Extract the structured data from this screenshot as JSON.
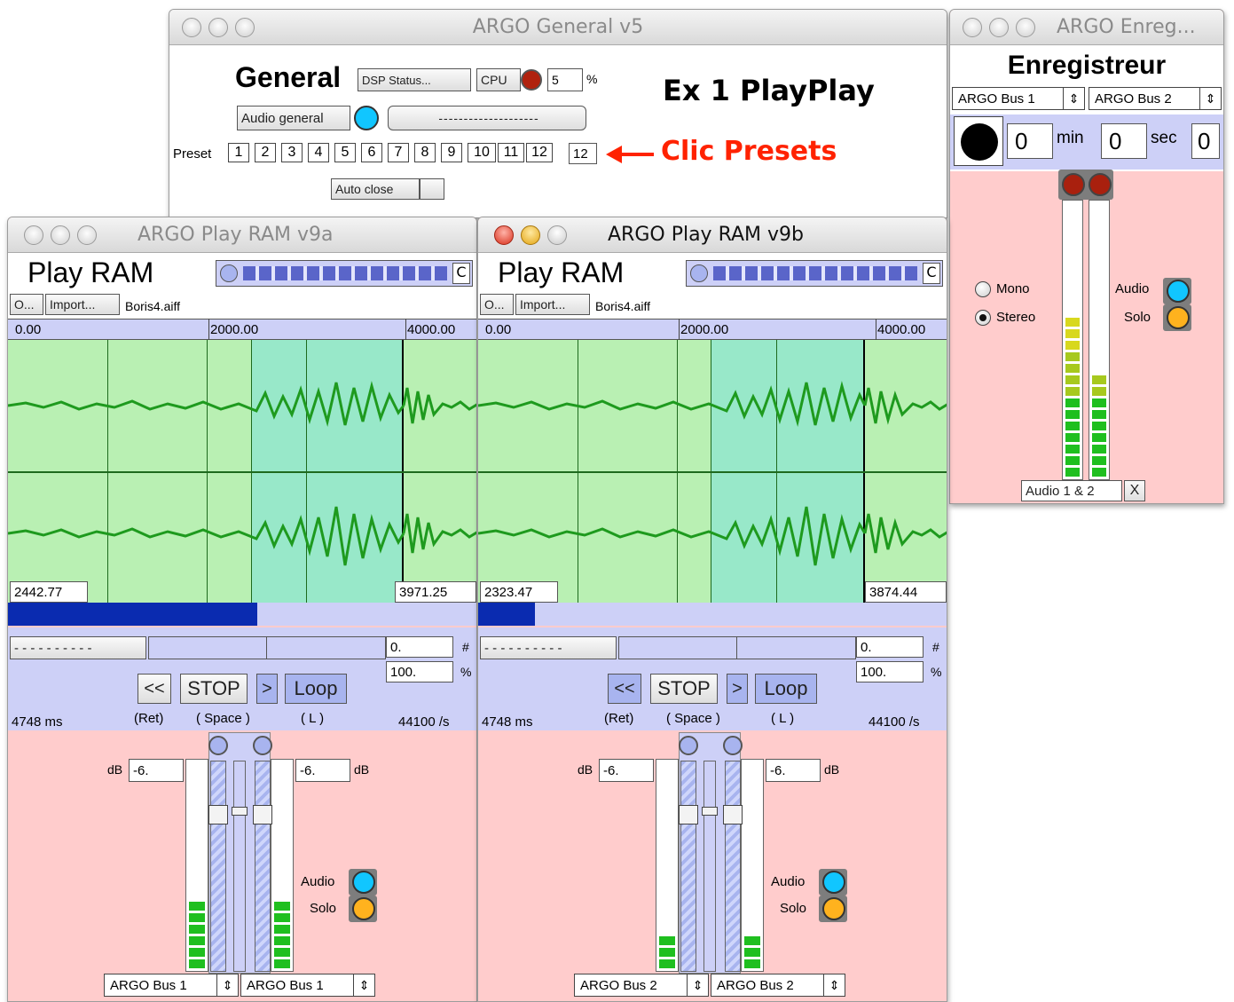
{
  "general": {
    "title": "ARGO General v5",
    "heading": "General",
    "dsp_label": "DSP Status...",
    "cpu_label": "CPU",
    "cpu_value": "5",
    "cpu_unit": "%",
    "audio_general_label": "Audio general",
    "dashes_field": "--------------------",
    "example_title": "Ex 1 PlayPlay",
    "preset_label": "Preset",
    "presets": [
      "1",
      "2",
      "3",
      "4",
      "5",
      "6",
      "7",
      "8",
      "9",
      "10",
      "11",
      "12"
    ],
    "preset_current": "12",
    "clic_presets": "Clic Presets",
    "auto_close_label": "Auto close"
  },
  "enregistreur": {
    "title": "ARGO Enreg...",
    "heading": "Enregistreur",
    "bus_left": "ARGO Bus 1",
    "bus_right": "ARGO Bus 2",
    "min_value": "0",
    "min_label": "min",
    "sec_value": "0",
    "sec_label": "sec",
    "extra_value": "0",
    "mono_label": "Mono",
    "stereo_label": "Stereo",
    "audio_label": "Audio",
    "solo_label": "Solo",
    "channels_menu": "Audio 1 & 2",
    "close_x": "X",
    "meter_levels": [
      0.6,
      0.4
    ]
  },
  "play_a": {
    "title": "ARGO Play RAM v9a",
    "heading": "Play RAM",
    "c_label": "C",
    "o_button": "O...",
    "import_button": "Import...",
    "filename": "Boris4.aiff",
    "ruler": [
      "0.00",
      "2000.00",
      "4000.00"
    ],
    "sel_start": "2442.77",
    "sel_end": "3971.25",
    "progress": 0.53,
    "dashes": "- - - - - - - - - -",
    "field_a": "0.",
    "field_a_unit": "#",
    "field_b": "100.",
    "field_b_unit": "%",
    "rewind_label": "<<",
    "stop_label": "STOP",
    "play_label": ">",
    "loop_label": "Loop",
    "ret_label": "(Ret)",
    "space_label": "( Space )",
    "l_label": "( L )",
    "duration": "4748 ms",
    "rate": "44100 /s",
    "db_label": "dB",
    "db_left": "-6.",
    "db_right": "-6.",
    "audio_label": "Audio",
    "solo_label": "Solo",
    "bus_left": "ARGO Bus 1",
    "bus_right": "ARGO Bus 1",
    "meter_levels": [
      0.35,
      0.35
    ]
  },
  "play_b": {
    "title": "ARGO Play RAM v9b",
    "heading": "Play RAM",
    "c_label": "C",
    "o_button": "O...",
    "import_button": "Import...",
    "filename": "Boris4.aiff",
    "ruler": [
      "0.00",
      "2000.00",
      "4000.00"
    ],
    "sel_start": "2323.47",
    "sel_end": "3874.44",
    "progress": 0.12,
    "dashes": "- - - - - - - - - -",
    "field_a": "0.",
    "field_a_unit": "#",
    "field_b": "100.",
    "field_b_unit": "%",
    "rewind_label": "<<",
    "stop_label": "STOP",
    "play_label": ">",
    "loop_label": "Loop",
    "ret_label": "(Ret)",
    "space_label": "( Space )",
    "l_label": "( L )",
    "duration": "4748 ms",
    "rate": "44100 /s",
    "db_label": "dB",
    "db_left": "-6.",
    "db_right": "-6.",
    "audio_label": "Audio",
    "solo_label": "Solo",
    "bus_left": "ARGO Bus 2",
    "bus_right": "ARGO Bus 2",
    "meter_levels": [
      0.15,
      0.15
    ]
  },
  "colors": {
    "pink_panel": "#ffcccc",
    "lavender_panel": "#cdd0f7",
    "wave_bg": "#b9f0b3",
    "selection": "#98e8c9",
    "waveform": "#1e9a1e",
    "progress_fill": "#0a2bb0",
    "red_arrow": "#ff2200",
    "cyan_led": "#11c6ff",
    "orange_led": "#ffb21e",
    "cpu_led": "#b0220e"
  }
}
